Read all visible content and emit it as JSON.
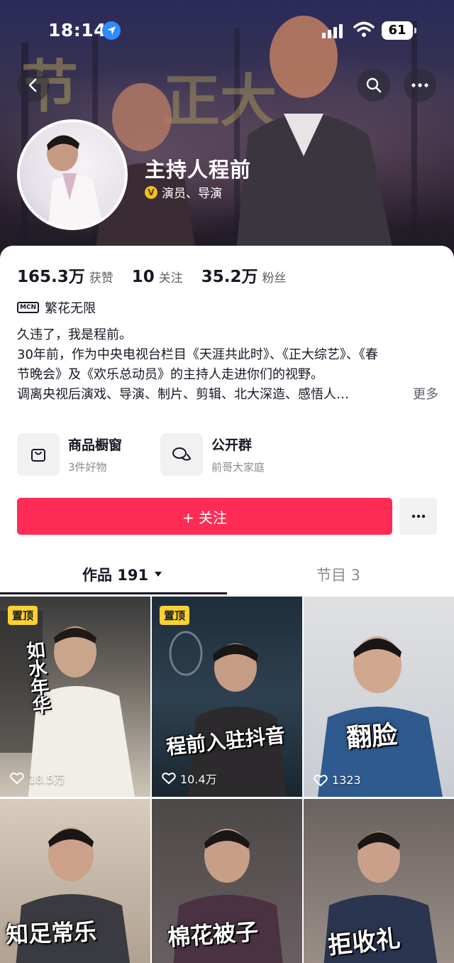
{
  "status": {
    "time": "18:14",
    "battery": "61"
  },
  "profile": {
    "name": "主持人程前",
    "verify_label": "演员、导演",
    "stats": [
      {
        "value": "165.3万",
        "label": "获赞"
      },
      {
        "value": "10",
        "label": "关注"
      },
      {
        "value": "35.2万",
        "label": "粉丝"
      }
    ],
    "mcn_tag": "MCN",
    "mcn_name": "繁花无限",
    "bio": [
      "久违了，我是程前。",
      "30年前，作为中央电视台栏目《天涯共此时》、《正大综艺》、《春",
      "节晚会》及《欢乐总动员》的主持人走进你们的视野。",
      "调离央视后演戏、导演、制片、剪辑、北大深造、感悟人…"
    ],
    "bio_more": "更多"
  },
  "features": {
    "shop": {
      "title": "商品橱窗",
      "sub": "3件好物"
    },
    "group": {
      "title": "公开群",
      "sub": "前哥大家庭"
    }
  },
  "follow": {
    "label": "+ 关注"
  },
  "tabs": {
    "works": "作品 191",
    "shows": "节目 3"
  },
  "videos": [
    {
      "pinned": true,
      "pin_label": "置顶",
      "likes": "18.5万",
      "overlay": "如水年华"
    },
    {
      "pinned": true,
      "pin_label": "置顶",
      "likes": "10.4万",
      "overlay": "程前入驻抖音"
    },
    {
      "pinned": false,
      "likes": "1323",
      "overlay": "翻脸"
    },
    {
      "pinned": false,
      "overlay": "知足常乐"
    },
    {
      "pinned": false,
      "overlay": "棉花被子"
    },
    {
      "pinned": false,
      "overlay": "拒收礼"
    }
  ],
  "colors": {
    "accent": "#fe2c55",
    "pin": "#fad232",
    "verify": "#f4c022"
  }
}
